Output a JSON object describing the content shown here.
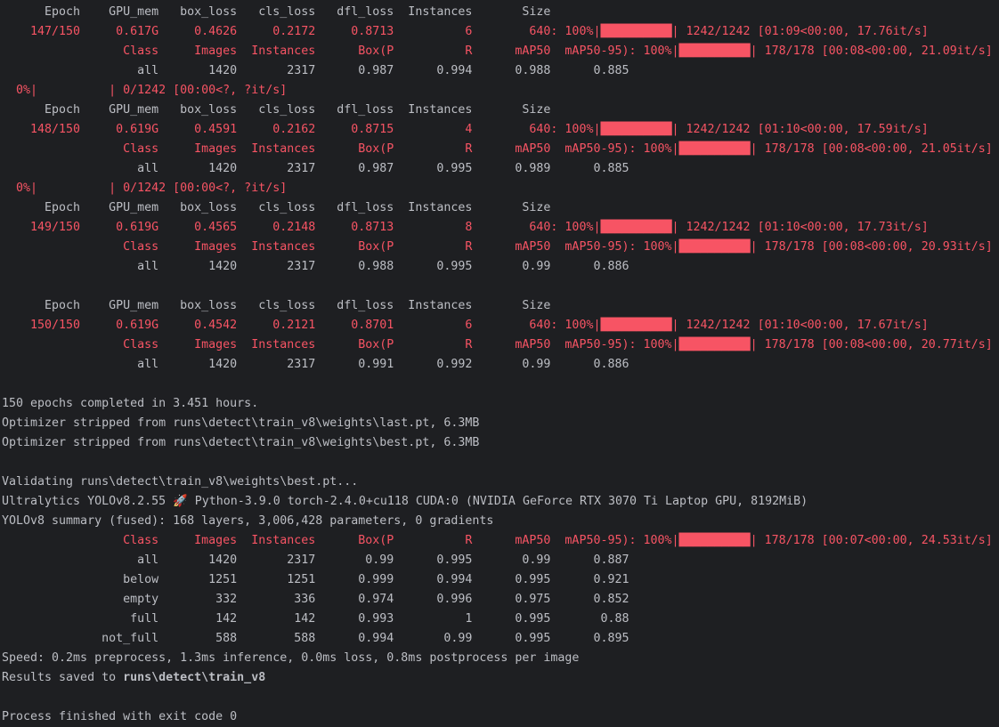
{
  "colors": {
    "background": "#1e1f22",
    "text": "#bcbec4",
    "stderr": "#f75464"
  },
  "lines": [
    {
      "t": "      Epoch    GPU_mem   box_loss   cls_loss   dfl_loss  Instances       Size",
      "c": "gray"
    },
    {
      "t": "    147/150     0.617G     0.4626     0.2172     0.8713          6        640: 100%|██████████| 1242/1242 [01:09<00:00, 17.76it/s]",
      "c": "red"
    },
    {
      "t": "                 Class     Images  Instances      Box(P          R      mAP50  mAP50-95): 100%|██████████| 178/178 [00:08<00:00, 21.09it/s]",
      "c": "red"
    },
    {
      "t": "                   all       1420       2317      0.987      0.994      0.988      0.885",
      "c": "gray"
    },
    {
      "t": "  0%|          | 0/1242 [00:00<?, ?it/s]",
      "c": "red"
    },
    {
      "t": "      Epoch    GPU_mem   box_loss   cls_loss   dfl_loss  Instances       Size",
      "c": "gray"
    },
    {
      "t": "    148/150     0.619G     0.4591     0.2162     0.8715          4        640: 100%|██████████| 1242/1242 [01:10<00:00, 17.59it/s]",
      "c": "red"
    },
    {
      "t": "                 Class     Images  Instances      Box(P          R      mAP50  mAP50-95): 100%|██████████| 178/178 [00:08<00:00, 21.05it/s]",
      "c": "red"
    },
    {
      "t": "                   all       1420       2317      0.987      0.995      0.989      0.885",
      "c": "gray"
    },
    {
      "t": "  0%|          | 0/1242 [00:00<?, ?it/s]",
      "c": "red"
    },
    {
      "t": "      Epoch    GPU_mem   box_loss   cls_loss   dfl_loss  Instances       Size",
      "c": "gray"
    },
    {
      "t": "    149/150     0.619G     0.4565     0.2148     0.8713          8        640: 100%|██████████| 1242/1242 [01:10<00:00, 17.73it/s]",
      "c": "red"
    },
    {
      "t": "                 Class     Images  Instances      Box(P          R      mAP50  mAP50-95): 100%|██████████| 178/178 [00:08<00:00, 20.93it/s]",
      "c": "red"
    },
    {
      "t": "                   all       1420       2317      0.988      0.995       0.99      0.886",
      "c": "gray"
    },
    {
      "t": "",
      "c": "gray"
    },
    {
      "t": "      Epoch    GPU_mem   box_loss   cls_loss   dfl_loss  Instances       Size",
      "c": "gray"
    },
    {
      "t": "    150/150     0.619G     0.4542     0.2121     0.8701          6        640: 100%|██████████| 1242/1242 [01:10<00:00, 17.67it/s]",
      "c": "red"
    },
    {
      "t": "                 Class     Images  Instances      Box(P          R      mAP50  mAP50-95): 100%|██████████| 178/178 [00:08<00:00, 20.77it/s]",
      "c": "red"
    },
    {
      "t": "                   all       1420       2317      0.991      0.992       0.99      0.886",
      "c": "gray"
    },
    {
      "t": "",
      "c": "gray"
    },
    {
      "t": "150 epochs completed in 3.451 hours.",
      "c": "gray"
    },
    {
      "t": "Optimizer stripped from runs\\detect\\train_v8\\weights\\last.pt, 6.3MB",
      "c": "gray"
    },
    {
      "t": "Optimizer stripped from runs\\detect\\train_v8\\weights\\best.pt, 6.3MB",
      "c": "gray"
    },
    {
      "t": "",
      "c": "gray"
    },
    {
      "t": "Validating runs\\detect\\train_v8\\weights\\best.pt...",
      "c": "gray"
    },
    {
      "t": "Ultralytics YOLOv8.2.55 🚀 Python-3.9.0 torch-2.4.0+cu118 CUDA:0 (NVIDIA GeForce RTX 3070 Ti Laptop GPU, 8192MiB)",
      "c": "gray"
    },
    {
      "t": "YOLOv8 summary (fused): 168 layers, 3,006,428 parameters, 0 gradients",
      "c": "gray"
    },
    {
      "t": "                 Class     Images  Instances      Box(P          R      mAP50  mAP50-95): 100%|██████████| 178/178 [00:07<00:00, 24.53it/s]",
      "c": "red"
    },
    {
      "t": "                   all       1420       2317       0.99      0.995       0.99      0.887",
      "c": "gray"
    },
    {
      "t": "                 below       1251       1251      0.999      0.994      0.995      0.921",
      "c": "gray"
    },
    {
      "t": "                 empty        332        336      0.974      0.996      0.975      0.852",
      "c": "gray"
    },
    {
      "t": "                  full        142        142      0.993          1      0.995       0.88",
      "c": "gray"
    },
    {
      "t": "              not_full        588        588      0.994       0.99      0.995      0.895",
      "c": "gray"
    },
    {
      "t": "Speed: 0.2ms preprocess, 1.3ms inference, 0.0ms loss, 0.8ms postprocess per image",
      "c": "gray"
    },
    {
      "t": "",
      "c": "gray"
    },
    {
      "t": "",
      "c": "gray"
    },
    {
      "t": "Process finished with exit code 0",
      "c": "gray"
    }
  ],
  "results_saved": {
    "prefix": "Results saved to ",
    "path": "runs\\detect\\train_v8"
  }
}
